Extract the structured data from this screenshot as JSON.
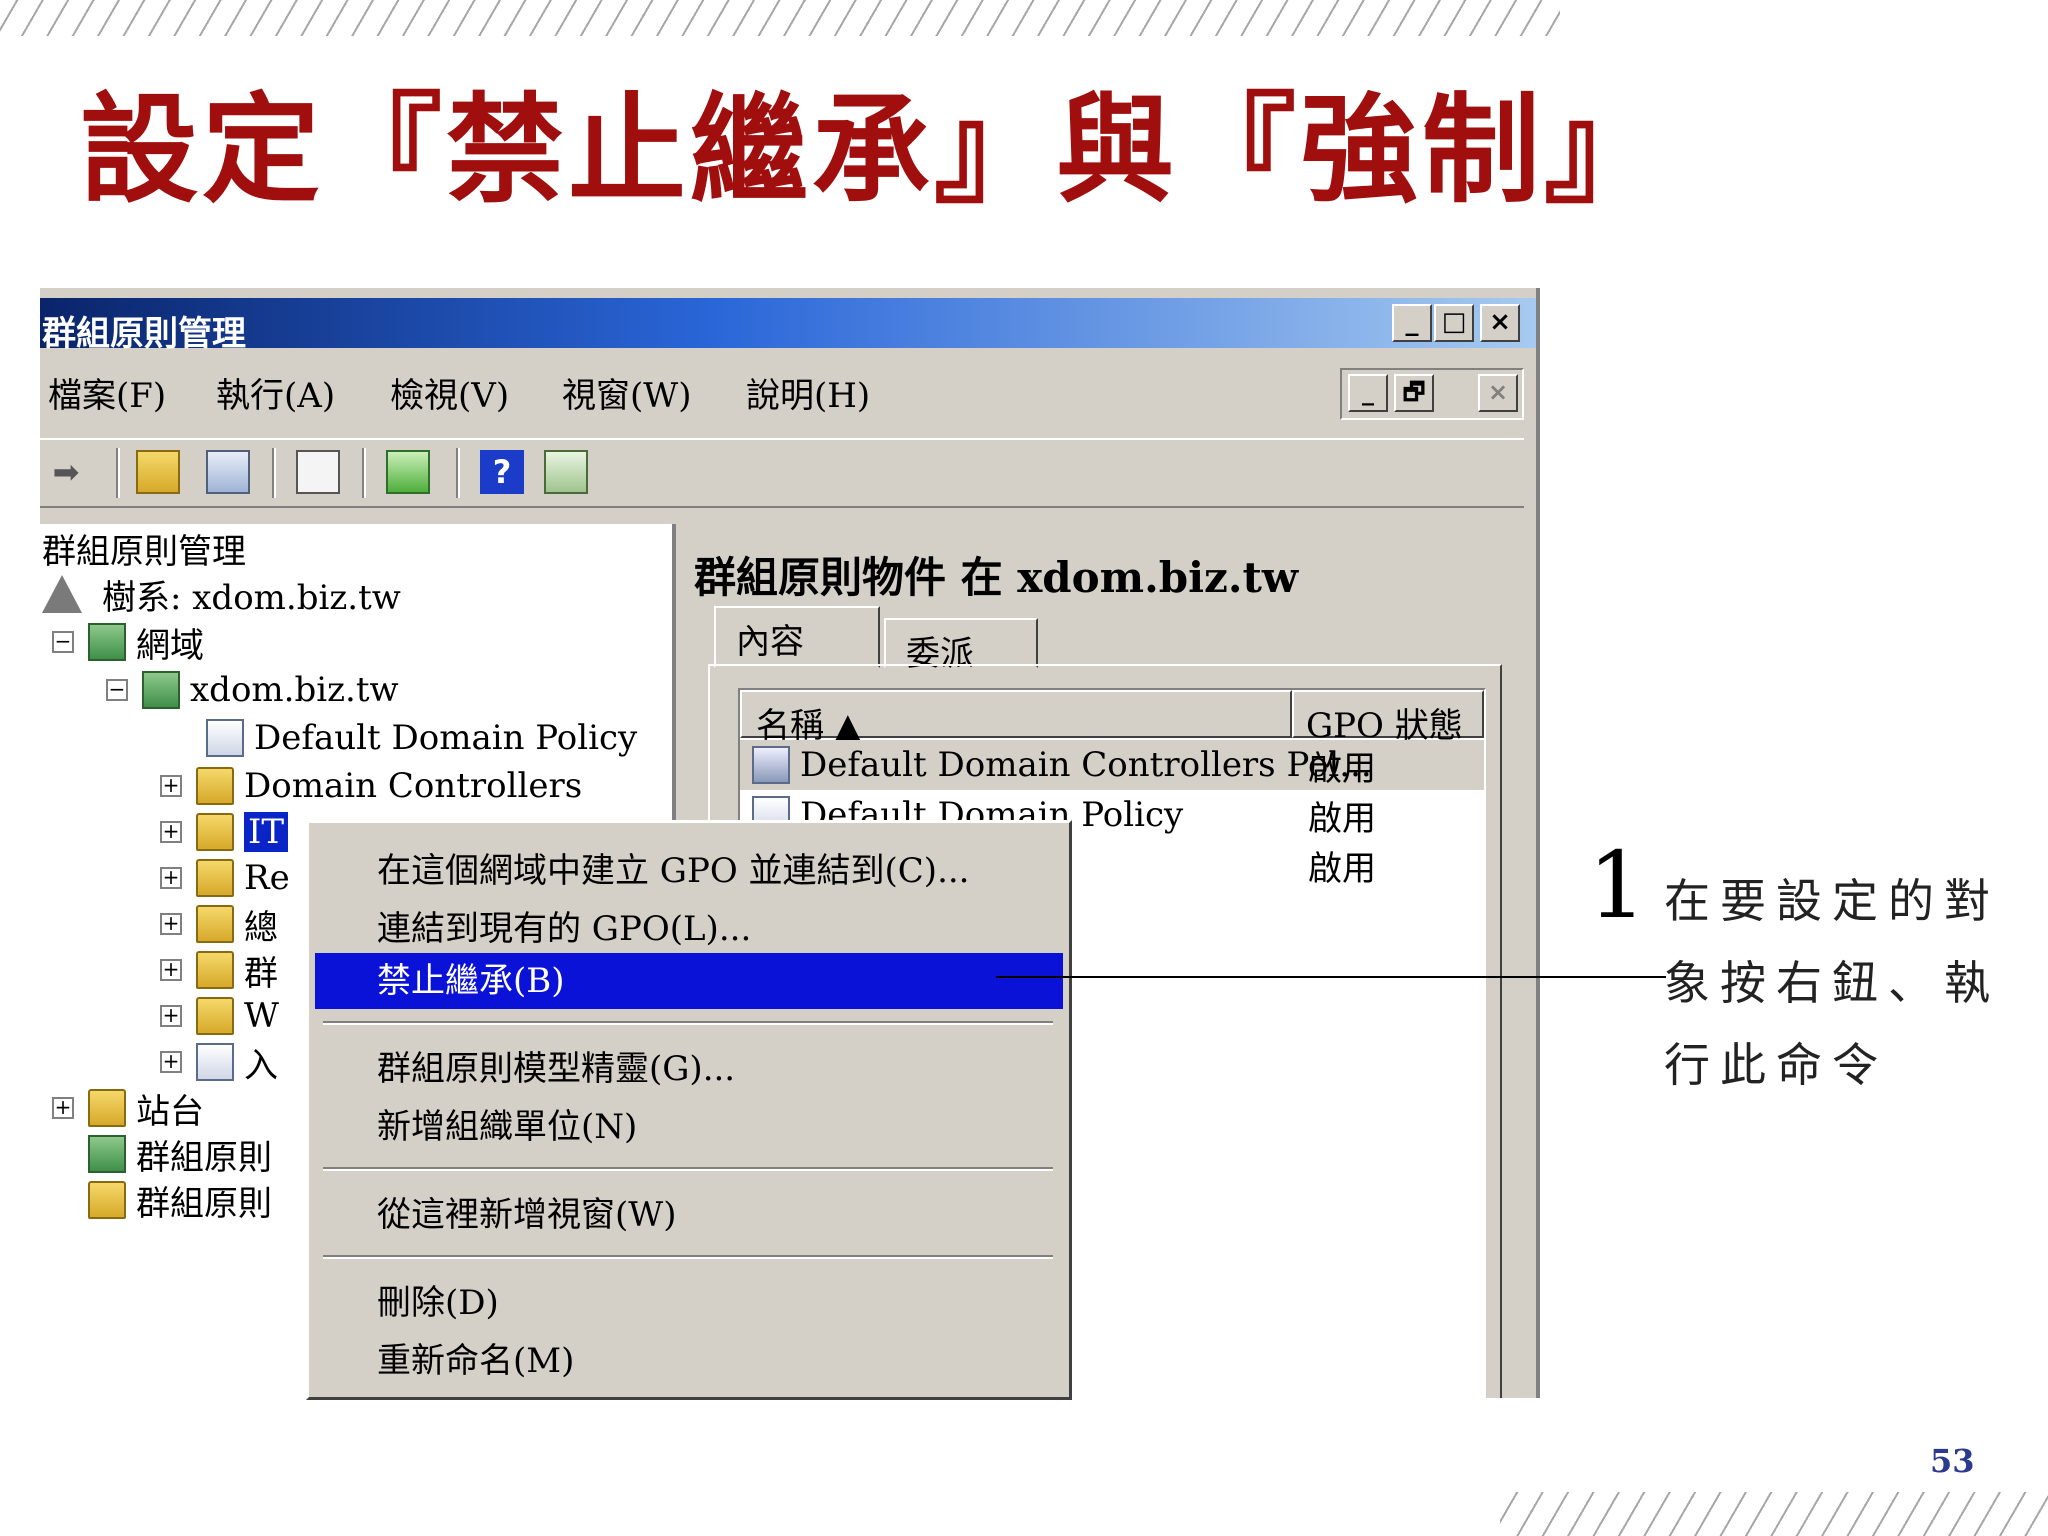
{
  "slide": {
    "title": "設定『禁止繼承』與『強制』",
    "page_number": "53"
  },
  "window": {
    "title": "群組原則管理",
    "controls": {
      "minimize": "_",
      "maximize": "□",
      "close": "×"
    },
    "mdi_controls": {
      "minimize": "_",
      "restore": "🗗",
      "close": "×"
    }
  },
  "menubar": {
    "items": [
      "檔案(F)",
      "執行(A)",
      "檢視(V)",
      "視窗(W)",
      "說明(H)"
    ]
  },
  "toolbar": {
    "icons": [
      "forward-arrow-icon",
      "up-folder-icon",
      "show-tree-icon",
      "clipboard-icon",
      "refresh-icon",
      "help-icon",
      "action-pane-icon"
    ]
  },
  "tree": {
    "root": "群組原則管理",
    "forest": "樹系: xdom.biz.tw",
    "domains": "網域",
    "domain": "xdom.biz.tw",
    "default_policy": "Default Domain Policy",
    "domain_controllers": "Domain Controllers",
    "it_ou": "IT",
    "re_partial": "Re",
    "zong_partial": "總",
    "qun_partial": "群",
    "w_partial": "W",
    "ru_partial": "入",
    "sites": "站台",
    "gp_modeling_partial": "群組原則",
    "gp_results_partial": "群組原則"
  },
  "right_pane": {
    "heading": "群組原則物件 在 xdom.biz.tw",
    "tabs": [
      "內容",
      "委派"
    ],
    "columns": [
      "名稱 ▲",
      "GPO 狀態"
    ],
    "rows": [
      {
        "name": "Default Domain Controllers Pol...",
        "status": "啟用"
      },
      {
        "name": "Default Domain Policy",
        "status": "啟用"
      },
      {
        "name": "",
        "status": "啟用"
      }
    ]
  },
  "context_menu": {
    "items": [
      "在這個網域中建立 GPO 並連結到(C)...",
      "連結到現有的 GPO(L)...",
      "禁止繼承(B)",
      "群組原則模型精靈(G)...",
      "新增組織單位(N)",
      "從這裡新增視窗(W)",
      "刪除(D)",
      "重新命名(M)"
    ]
  },
  "annotation": {
    "number": "1",
    "text": "在要設定的對象按右鈕、執行此命令"
  }
}
